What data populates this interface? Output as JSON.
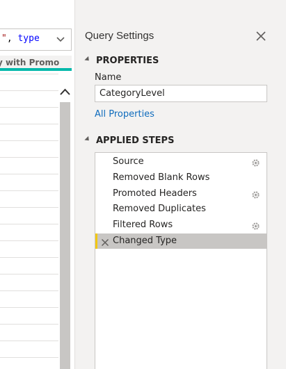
{
  "formula": {
    "quote": "\"",
    "comma": ",",
    "keyword": "type"
  },
  "grid": {
    "column_header": "Qty with Promo"
  },
  "pane": {
    "title": "Query Settings",
    "properties": {
      "heading": "PROPERTIES",
      "name_label": "Name",
      "name_value": "CategoryLevel",
      "all_properties_link": "All Properties"
    },
    "applied_steps": {
      "heading": "APPLIED STEPS",
      "steps": [
        {
          "label": "Source",
          "has_gear": true,
          "selected": false
        },
        {
          "label": "Removed Blank Rows",
          "has_gear": false,
          "selected": false
        },
        {
          "label": "Promoted Headers",
          "has_gear": true,
          "selected": false
        },
        {
          "label": "Removed Duplicates",
          "has_gear": false,
          "selected": false
        },
        {
          "label": "Filtered Rows",
          "has_gear": true,
          "selected": false
        },
        {
          "label": "Changed Type",
          "has_gear": false,
          "selected": true
        }
      ]
    }
  },
  "colors": {
    "accent_teal": "#01b8aa",
    "selected_mark": "#f2c811",
    "link": "#0f6cbd"
  }
}
